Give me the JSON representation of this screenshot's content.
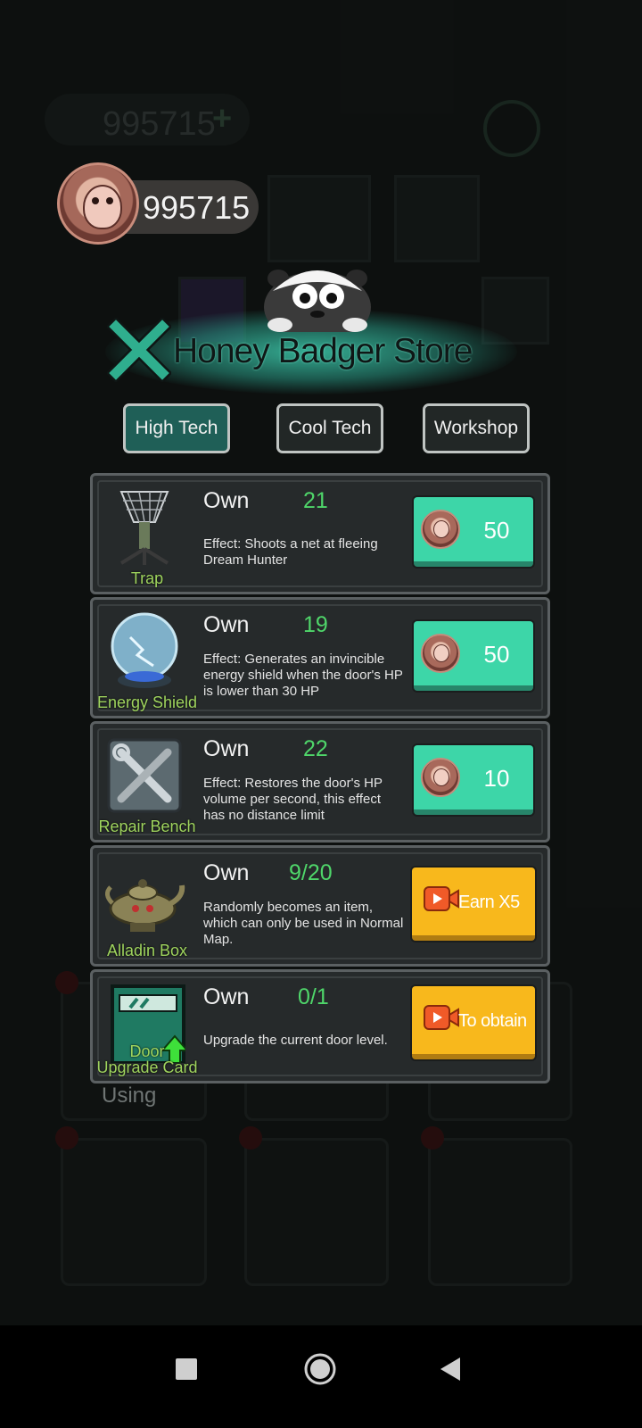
{
  "header": {
    "coin_balance": "995715",
    "background_balance": "995715"
  },
  "store": {
    "title": "Honey Badger Store",
    "close_icon": "close-x-icon"
  },
  "tabs": [
    {
      "label": "High Tech",
      "active": true
    },
    {
      "label": "Cool Tech",
      "active": false
    },
    {
      "label": "Workshop",
      "active": false
    }
  ],
  "items": [
    {
      "name": "Trap",
      "own_label": "Own",
      "own_count": "21",
      "effect": "Effect: Shoots a net at fleeing Dream Hunter",
      "price": "50",
      "action": "coin"
    },
    {
      "name": "Energy Shield",
      "own_label": "Own",
      "own_count": "19",
      "effect": "Effect: Generates an invincible energy shield when the door's HP is lower than 30 HP",
      "price": "50",
      "action": "coin"
    },
    {
      "name": "Repair Bench",
      "own_label": "Own",
      "own_count": "22",
      "effect": "Effect: Restores the door's HP volume per second, this effect has no distance limit",
      "price": "10",
      "action": "coin"
    },
    {
      "name": "Alladin Box",
      "own_label": "Own",
      "own_count": "9/20",
      "effect": "Randomly becomes an item, which can only be used in Normal Map.",
      "button": "Earn X5",
      "action": "video"
    },
    {
      "name_line1": "Door",
      "name_line2": "Upgrade Card",
      "own_label": "Own",
      "own_count": "0/1",
      "effect": "Upgrade the current door level.",
      "button": "To obtain",
      "action": "video"
    }
  ],
  "background": {
    "using_label": "Using"
  },
  "colors": {
    "accent_green": "#3dd6a8",
    "video_orange": "#f8b81c",
    "count_green": "#4fd66a",
    "active_tab": "#1f5f57"
  }
}
